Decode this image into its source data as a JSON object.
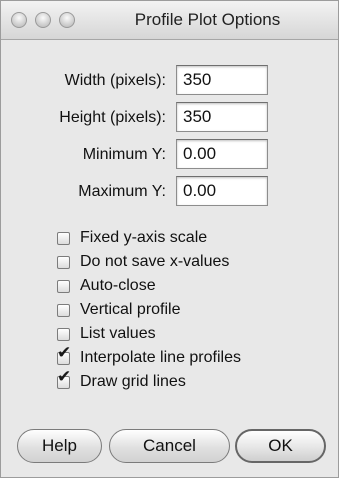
{
  "window": {
    "title": "Profile Plot Options"
  },
  "fields": [
    {
      "label": "Width (pixels):",
      "value": "350"
    },
    {
      "label": "Height (pixels):",
      "value": "350"
    },
    {
      "label": "Minimum Y:",
      "value": "0.00"
    },
    {
      "label": "Maximum Y:",
      "value": "0.00"
    }
  ],
  "options": [
    {
      "label": "Fixed y-axis scale",
      "checked": false
    },
    {
      "label": "Do not save x-values",
      "checked": false
    },
    {
      "label": "Auto-close",
      "checked": false
    },
    {
      "label": "Vertical profile",
      "checked": false
    },
    {
      "label": "List values",
      "checked": false
    },
    {
      "label": "Interpolate line profiles",
      "checked": true
    },
    {
      "label": "Draw grid lines",
      "checked": true
    }
  ],
  "buttons": {
    "help": "Help",
    "cancel": "Cancel",
    "ok": "OK"
  }
}
